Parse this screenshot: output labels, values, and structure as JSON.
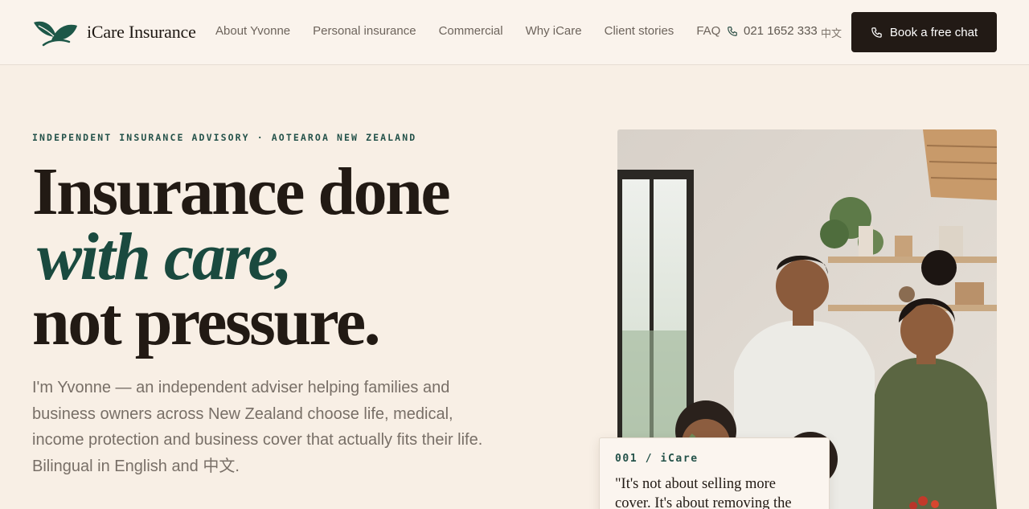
{
  "brand": {
    "name": "iCare Insurance",
    "logo_icon": "leaf-logo-icon"
  },
  "nav": {
    "items": [
      {
        "label": "About Yvonne"
      },
      {
        "label": "Personal insurance"
      },
      {
        "label": "Commercial"
      },
      {
        "label": "Why iCare"
      },
      {
        "label": "Client stories"
      },
      {
        "label": "FAQ"
      }
    ],
    "phone": {
      "icon": "phone-icon",
      "number": "021 1652 333"
    },
    "language": "中文",
    "cta": {
      "icon": "phone-icon",
      "label": "Book a free chat"
    }
  },
  "hero": {
    "eyebrow": "INDEPENDENT INSURANCE ADVISORY · AOTEAROA NEW ZEALAND",
    "headline": {
      "line1": "Insurance done",
      "line2": "with care,",
      "line3": "not pressure."
    },
    "lede": "I'm Yvonne — an independent adviser helping families and business owners across New Zealand choose life, medical, income protection and business cover that actually fits their life. Bilingual in English and 中文.",
    "image_subject": "family-cooking-photo"
  },
  "quote_card": {
    "tag": "001 / iCare",
    "text": "\"It's not about selling more cover. It's about removing the"
  },
  "colors": {
    "background": "#f8efe5",
    "header_bg": "#faf3ec",
    "accent_green": "#1a4a3f",
    "cta_bg": "#221a15",
    "text_dark": "#221a14",
    "text_muted": "#786f67"
  }
}
